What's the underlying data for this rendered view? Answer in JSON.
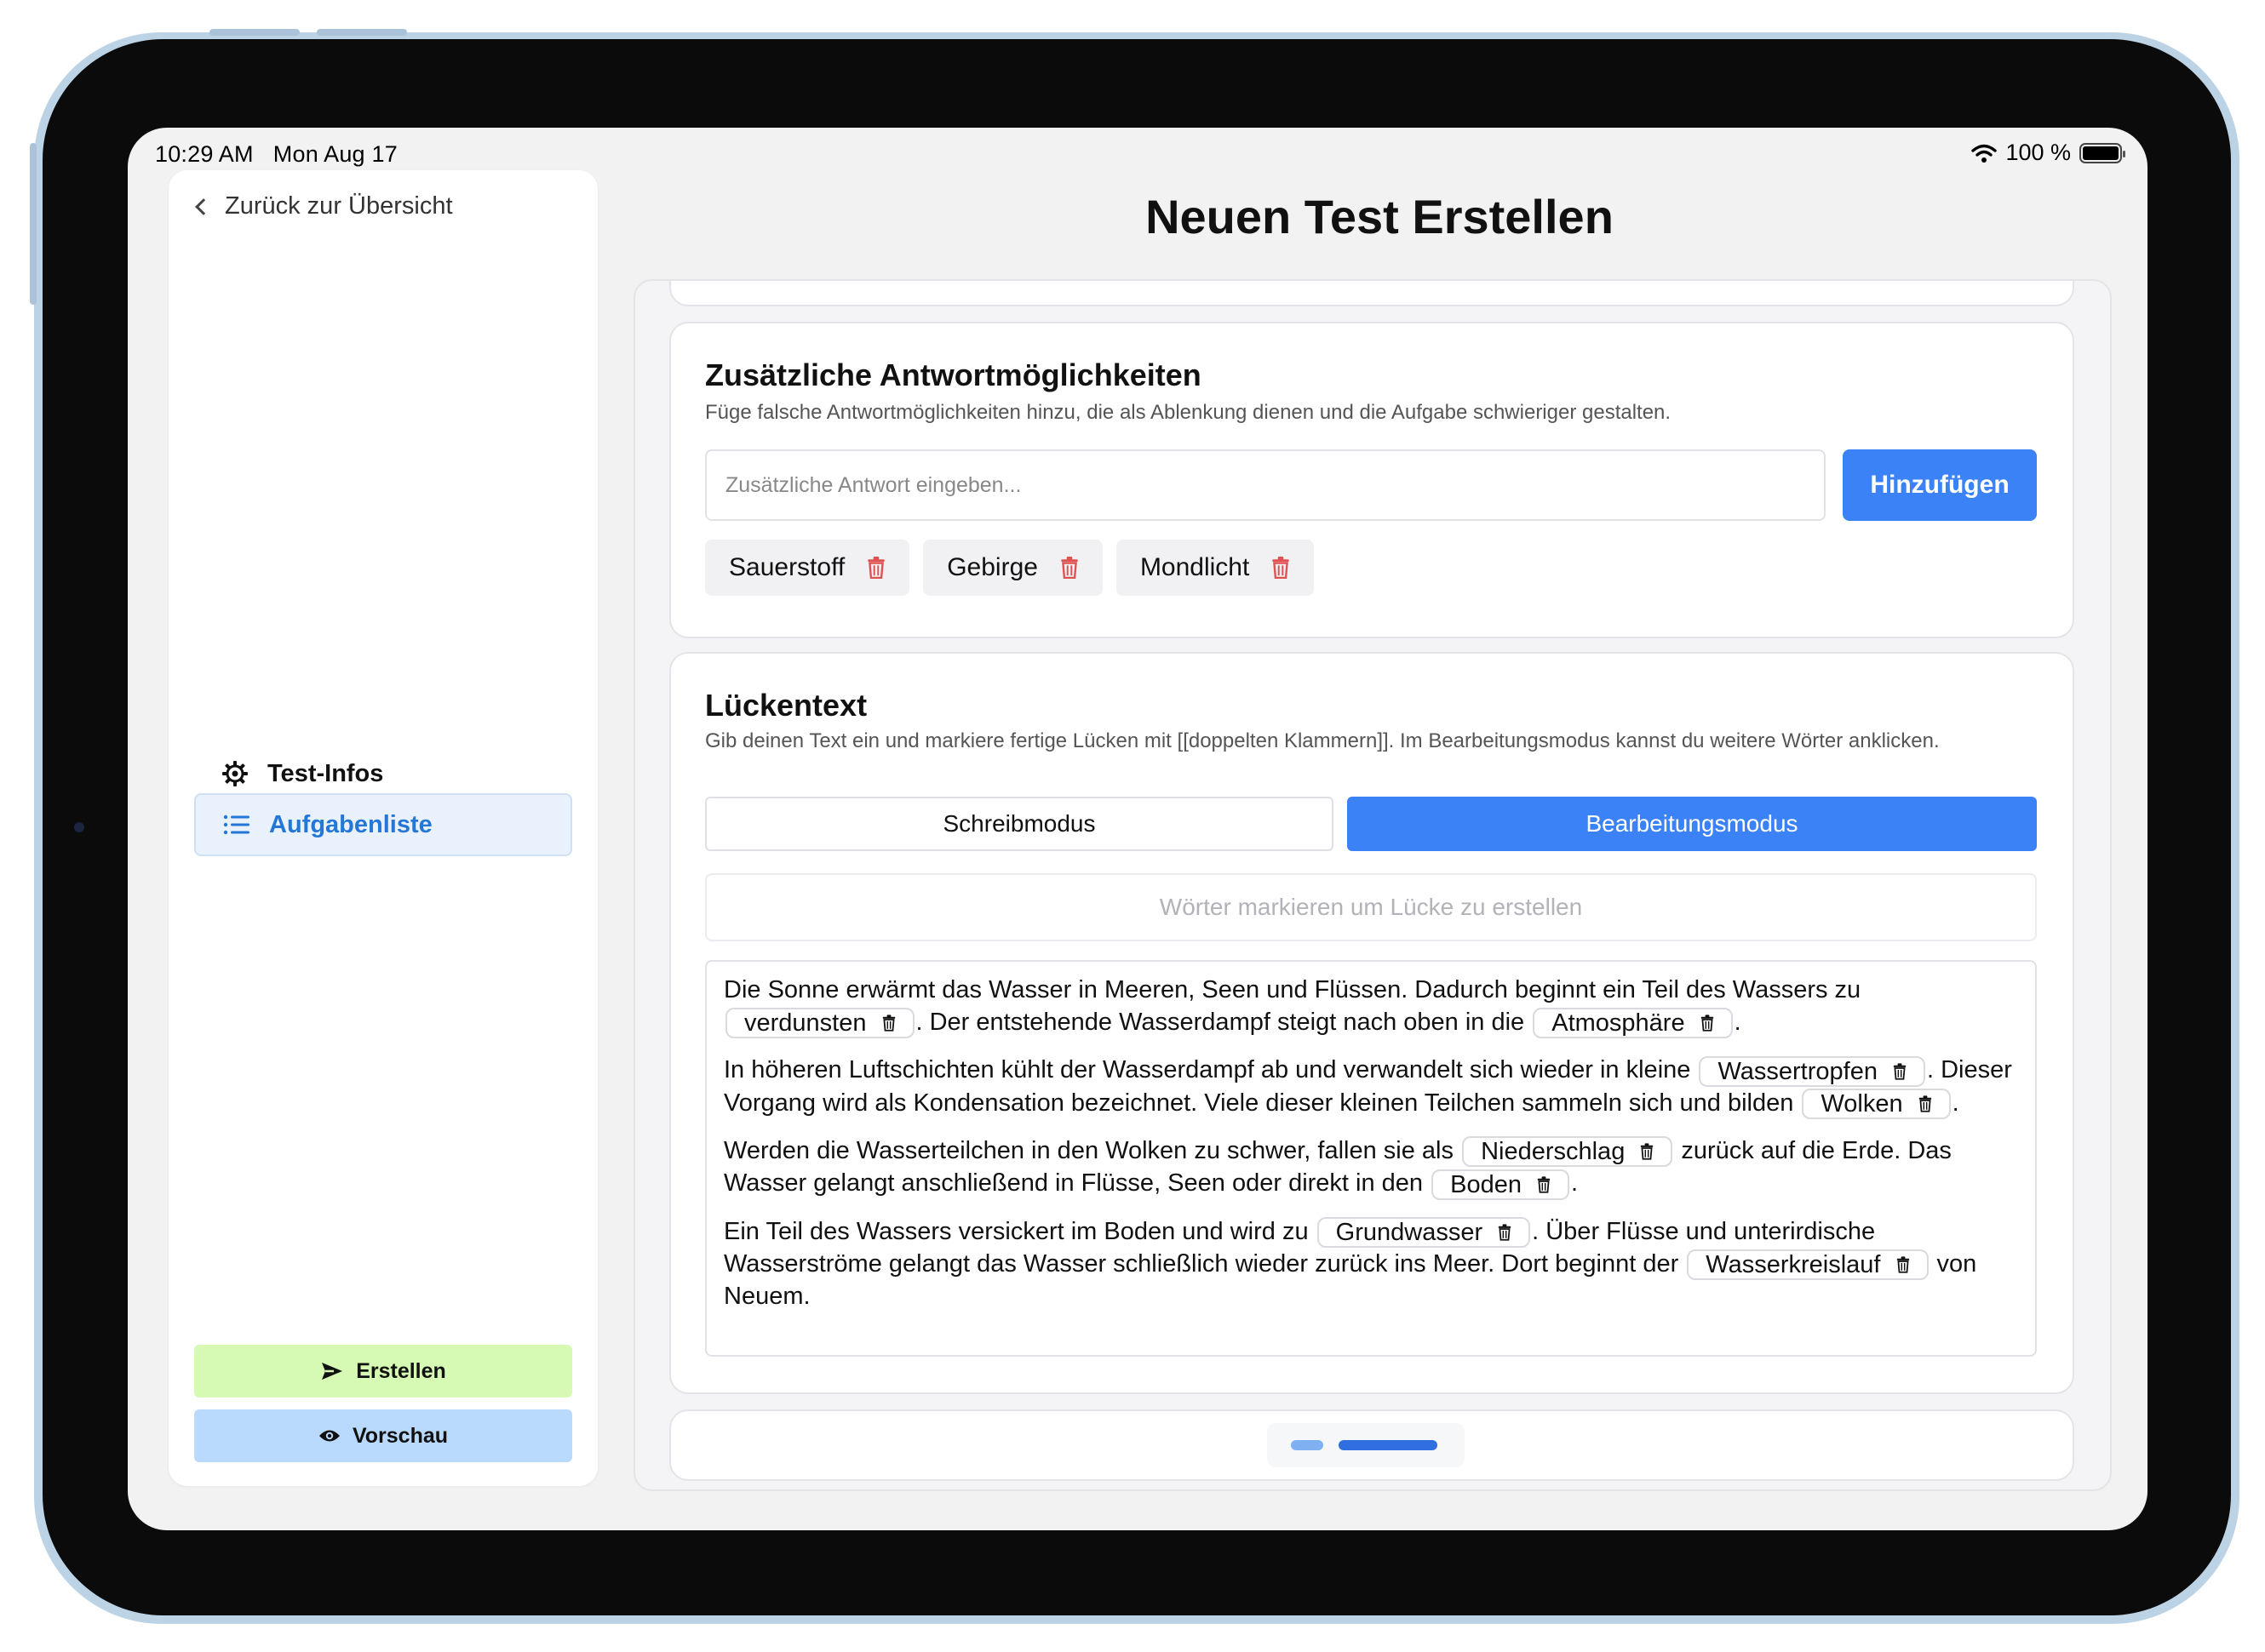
{
  "status_bar": {
    "time": "10:29 AM",
    "date": "Mon Aug 17",
    "battery": "100 %",
    "battery_level": 1.0
  },
  "sidebar": {
    "back_label": "Zurück zur Übersicht",
    "nav": [
      {
        "label": "Test-Infos",
        "icon": "gear-icon",
        "active": false
      },
      {
        "label": "Aufgabenliste",
        "icon": "list-icon",
        "active": true
      }
    ],
    "create_label": "Erstellen",
    "preview_label": "Vorschau"
  },
  "page": {
    "title": "Neuen Test Erstellen"
  },
  "extra_answers": {
    "title": "Zusätzliche Antwortmöglichkeiten",
    "subtitle": "Füge falsche Antwortmöglichkeiten hinzu, die als Ablenkung dienen und die Aufgabe schwieriger gestalten.",
    "input_placeholder": "Zusätzliche Antwort eingeben...",
    "input_value": "",
    "add_label": "Hinzufügen",
    "chips": [
      "Sauerstoff",
      "Gebirge",
      "Mondlicht"
    ]
  },
  "gap_text": {
    "title": "Lückentext",
    "subtitle": "Gib deinen Text ein und markiere fertige Lücken mit [[doppelten Klammern]]. Im Bearbeitungsmodus kannst du weitere Wörter anklicken.",
    "mode_write": "Schreibmodus",
    "mode_edit": "Bearbeitungsmodus",
    "active_mode": "edit",
    "hint": "Wörter markieren um Lücke zu erstellen",
    "paragraphs": [
      [
        {
          "t": "Die Sonne erwärmt das Wasser in Meeren, Seen und Flüssen. Dadurch beginnt ein Teil des Wassers zu "
        },
        {
          "gap": "verdunsten"
        },
        {
          "t": ". Der entstehende Wasserdampf steigt nach oben in die "
        },
        {
          "gap": "Atmosphäre"
        },
        {
          "t": "."
        }
      ],
      [
        {
          "t": "In höheren Luftschichten kühlt der Wasserdampf ab und verwandelt sich wieder in kleine "
        },
        {
          "gap": "Wassertropfen"
        },
        {
          "t": ". Dieser Vorgang wird als Kondensation bezeichnet. Viele dieser kleinen Teilchen sammeln sich und bilden "
        },
        {
          "gap": "Wolken"
        },
        {
          "t": "."
        }
      ],
      [
        {
          "t": "Werden die Wasserteilchen in den Wolken zu schwer, fallen sie als "
        },
        {
          "gap": "Niederschlag"
        },
        {
          "t": " zurück auf die Erde. Das Wasser gelangt anschließend in Flüsse, Seen oder direkt in den "
        },
        {
          "gap": "Boden"
        },
        {
          "t": "."
        }
      ],
      [
        {
          "t": "Ein Teil des Wassers versickert im Boden und wird zu "
        },
        {
          "gap": "Grundwasser"
        },
        {
          "t": ". Über Flüsse und unterirdische Wasserströme gelangt das Wasser schließlich wieder zurück ins Meer. Dort beginnt der "
        },
        {
          "gap": "Wasserkreislauf"
        },
        {
          "t": " von Neuem."
        }
      ]
    ]
  },
  "pager": {
    "total": 2,
    "current": 2
  },
  "colors": {
    "accent": "#3b82f6",
    "create_bg": "#d6fab3",
    "preview_bg": "#b9dafc",
    "delete_icon": "#e05252"
  }
}
